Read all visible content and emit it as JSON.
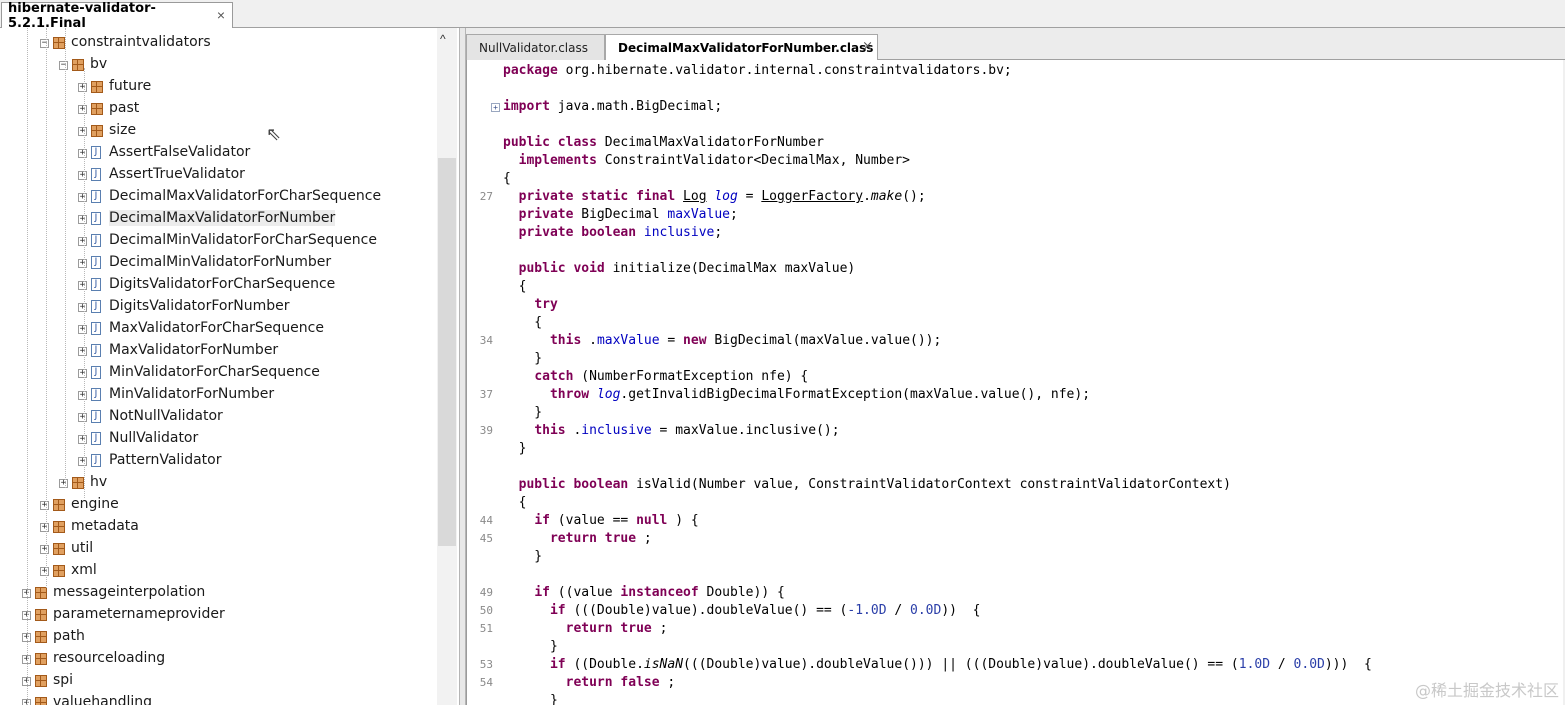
{
  "window_tab": {
    "title": "hibernate-validator-5.2.1.Final",
    "close": "×"
  },
  "tree": {
    "nodes": [
      {
        "label": "constraintvalidators",
        "kind": "package",
        "toggle": "−",
        "depth": 2
      },
      {
        "label": "bv",
        "kind": "package",
        "toggle": "−",
        "depth": 3
      },
      {
        "label": "future",
        "kind": "package",
        "toggle": "+",
        "depth": 4
      },
      {
        "label": "past",
        "kind": "package",
        "toggle": "+",
        "depth": 4
      },
      {
        "label": "size",
        "kind": "package",
        "toggle": "+",
        "depth": 4
      },
      {
        "label": "AssertFalseValidator",
        "kind": "class",
        "toggle": "+",
        "depth": 4
      },
      {
        "label": "AssertTrueValidator",
        "kind": "class",
        "toggle": "+",
        "depth": 4
      },
      {
        "label": "DecimalMaxValidatorForCharSequence",
        "kind": "class",
        "toggle": "+",
        "depth": 4
      },
      {
        "label": "DecimalMaxValidatorForNumber",
        "kind": "class",
        "toggle": "+",
        "depth": 4,
        "selected": true
      },
      {
        "label": "DecimalMinValidatorForCharSequence",
        "kind": "class",
        "toggle": "+",
        "depth": 4
      },
      {
        "label": "DecimalMinValidatorForNumber",
        "kind": "class",
        "toggle": "+",
        "depth": 4
      },
      {
        "label": "DigitsValidatorForCharSequence",
        "kind": "class",
        "toggle": "+",
        "depth": 4
      },
      {
        "label": "DigitsValidatorForNumber",
        "kind": "class",
        "toggle": "+",
        "depth": 4
      },
      {
        "label": "MaxValidatorForCharSequence",
        "kind": "class",
        "toggle": "+",
        "depth": 4
      },
      {
        "label": "MaxValidatorForNumber",
        "kind": "class",
        "toggle": "+",
        "depth": 4
      },
      {
        "label": "MinValidatorForCharSequence",
        "kind": "class",
        "toggle": "+",
        "depth": 4
      },
      {
        "label": "MinValidatorForNumber",
        "kind": "class",
        "toggle": "+",
        "depth": 4
      },
      {
        "label": "NotNullValidator",
        "kind": "class",
        "toggle": "+",
        "depth": 4
      },
      {
        "label": "NullValidator",
        "kind": "class",
        "toggle": "+",
        "depth": 4
      },
      {
        "label": "PatternValidator",
        "kind": "class",
        "toggle": "+",
        "depth": 4
      },
      {
        "label": "hv",
        "kind": "package",
        "toggle": "+",
        "depth": 3
      },
      {
        "label": "engine",
        "kind": "package",
        "toggle": "+",
        "depth": 2
      },
      {
        "label": "metadata",
        "kind": "package",
        "toggle": "+",
        "depth": 2
      },
      {
        "label": "util",
        "kind": "package",
        "toggle": "+",
        "depth": 2
      },
      {
        "label": "xml",
        "kind": "package",
        "toggle": "+",
        "depth": 2
      },
      {
        "label": "messageinterpolation",
        "kind": "package",
        "toggle": "+",
        "depth": 1
      },
      {
        "label": "parameternameprovider",
        "kind": "package",
        "toggle": "+",
        "depth": 1
      },
      {
        "label": "path",
        "kind": "package",
        "toggle": "+",
        "depth": 1
      },
      {
        "label": "resourceloading",
        "kind": "package",
        "toggle": "+",
        "depth": 1
      },
      {
        "label": "spi",
        "kind": "package",
        "toggle": "+",
        "depth": 1
      },
      {
        "label": "valuehandling",
        "kind": "package",
        "toggle": "+",
        "depth": 1
      }
    ],
    "scroll_up": "^"
  },
  "editor": {
    "tabs": [
      {
        "label": "NullValidator.class",
        "active": false
      },
      {
        "label": "DecimalMaxValidatorForNumber.class",
        "active": true,
        "close": "×"
      }
    ],
    "lines": [
      {
        "n": "",
        "fold": "",
        "segs": [
          [
            "kw",
            "package"
          ],
          [
            "",
            "org.hibernate.validator.internal.constraintvalidators.bv;"
          ]
        ]
      },
      {
        "n": "",
        "fold": "",
        "segs": []
      },
      {
        "n": "",
        "fold": "+",
        "segs": [
          [
            "kw",
            "import"
          ],
          [
            "",
            "java.math.BigDecimal;"
          ]
        ]
      },
      {
        "n": "",
        "fold": "",
        "segs": []
      },
      {
        "n": "",
        "fold": "",
        "segs": [
          [
            "kw",
            "public"
          ],
          [
            "",
            " "
          ],
          [
            "kw",
            "class"
          ],
          [
            "",
            " DecimalMaxValidatorForNumber"
          ]
        ]
      },
      {
        "n": "",
        "fold": "",
        "segs": [
          [
            "",
            "  "
          ],
          [
            "kw",
            "implements"
          ],
          [
            "",
            " ConstraintValidator<DecimalMax, Number>"
          ]
        ]
      },
      {
        "n": "",
        "fold": "",
        "segs": [
          [
            "",
            "{"
          ]
        ]
      },
      {
        "n": "27",
        "fold": "",
        "segs": [
          [
            "",
            "  "
          ],
          [
            "kw",
            "private"
          ],
          [
            "",
            " "
          ],
          [
            "kw",
            "static"
          ],
          [
            "",
            " "
          ],
          [
            "kw",
            "final"
          ],
          [
            "",
            " "
          ],
          [
            "ul",
            "Log"
          ],
          [
            "",
            " "
          ],
          [
            "fld ital",
            "log"
          ],
          [
            "",
            " = "
          ],
          [
            "ul",
            "LoggerFactory"
          ],
          [
            "",
            "."
          ],
          [
            "ital",
            "make"
          ],
          [
            "",
            "();"
          ]
        ]
      },
      {
        "n": "",
        "fold": "",
        "segs": [
          [
            "",
            "  "
          ],
          [
            "kw",
            "private"
          ],
          [
            "",
            " BigDecimal "
          ],
          [
            "fld",
            "maxValue"
          ],
          [
            "",
            ";"
          ]
        ]
      },
      {
        "n": "",
        "fold": "",
        "segs": [
          [
            "",
            "  "
          ],
          [
            "kw",
            "private"
          ],
          [
            "",
            " "
          ],
          [
            "kw",
            "boolean"
          ],
          [
            "",
            " "
          ],
          [
            "fld",
            "inclusive"
          ],
          [
            "",
            ";"
          ]
        ]
      },
      {
        "n": "",
        "fold": "",
        "segs": []
      },
      {
        "n": "",
        "fold": "",
        "segs": [
          [
            "",
            "  "
          ],
          [
            "kw",
            "public"
          ],
          [
            "",
            " "
          ],
          [
            "kw",
            "void"
          ],
          [
            "",
            " initialize(DecimalMax maxValue)"
          ]
        ]
      },
      {
        "n": "",
        "fold": "",
        "segs": [
          [
            "",
            "  {"
          ]
        ]
      },
      {
        "n": "",
        "fold": "",
        "segs": [
          [
            "",
            "    "
          ],
          [
            "kw",
            "try"
          ]
        ]
      },
      {
        "n": "",
        "fold": "",
        "segs": [
          [
            "",
            "    {"
          ]
        ]
      },
      {
        "n": "34",
        "fold": "",
        "segs": [
          [
            "",
            "      "
          ],
          [
            "kw",
            "this"
          ],
          [
            "",
            "."
          ],
          [
            "fld",
            "maxValue"
          ],
          [
            "",
            " = "
          ],
          [
            "kw",
            "new"
          ],
          [
            "",
            " BigDecimal(maxValue.value());"
          ]
        ]
      },
      {
        "n": "",
        "fold": "",
        "segs": [
          [
            "",
            "    }"
          ]
        ]
      },
      {
        "n": "",
        "fold": "",
        "segs": [
          [
            "",
            "    "
          ],
          [
            "kw",
            "catch"
          ],
          [
            "",
            " (NumberFormatException nfe) {"
          ]
        ]
      },
      {
        "n": "37",
        "fold": "",
        "segs": [
          [
            "",
            "      "
          ],
          [
            "kw",
            "throw"
          ],
          [
            "",
            " "
          ],
          [
            "fld ital",
            "log"
          ],
          [
            "",
            ".getInvalidBigDecimalFormatException(maxValue.value(), nfe);"
          ]
        ]
      },
      {
        "n": "",
        "fold": "",
        "segs": [
          [
            "",
            "    }"
          ]
        ]
      },
      {
        "n": "39",
        "fold": "",
        "segs": [
          [
            "",
            "    "
          ],
          [
            "kw",
            "this"
          ],
          [
            "",
            "."
          ],
          [
            "fld",
            "inclusive"
          ],
          [
            "",
            " = maxValue.inclusive();"
          ]
        ]
      },
      {
        "n": "",
        "fold": "",
        "segs": [
          [
            "",
            "  }"
          ]
        ]
      },
      {
        "n": "",
        "fold": "",
        "segs": []
      },
      {
        "n": "",
        "fold": "",
        "segs": [
          [
            "",
            "  "
          ],
          [
            "kw",
            "public"
          ],
          [
            "",
            " "
          ],
          [
            "kw",
            "boolean"
          ],
          [
            "",
            " isValid(Number value, ConstraintValidatorContext constraintValidatorContext)"
          ]
        ]
      },
      {
        "n": "",
        "fold": "",
        "segs": [
          [
            "",
            "  {"
          ]
        ]
      },
      {
        "n": "44",
        "fold": "",
        "segs": [
          [
            "",
            "    "
          ],
          [
            "kw",
            "if"
          ],
          [
            "",
            " (value == "
          ],
          [
            "kw",
            "null"
          ],
          [
            "",
            ") {"
          ]
        ]
      },
      {
        "n": "45",
        "fold": "",
        "segs": [
          [
            "",
            "      "
          ],
          [
            "kw",
            "return"
          ],
          [
            "",
            " "
          ],
          [
            "kw",
            "true"
          ],
          [
            "",
            ";"
          ]
        ]
      },
      {
        "n": "",
        "fold": "",
        "segs": [
          [
            "",
            "    }"
          ]
        ]
      },
      {
        "n": "",
        "fold": "",
        "segs": []
      },
      {
        "n": "49",
        "fold": "",
        "segs": [
          [
            "",
            "    "
          ],
          [
            "kw",
            "if"
          ],
          [
            "",
            " ((value "
          ],
          [
            "kw",
            "instanceof"
          ],
          [
            "",
            " Double)) {"
          ]
        ]
      },
      {
        "n": "50",
        "fold": "",
        "segs": [
          [
            "",
            "      "
          ],
          [
            "kw",
            "if"
          ],
          [
            "",
            " (((Double)value).doubleValue() == ("
          ],
          [
            "num",
            "-1.0D"
          ],
          [
            "",
            " / "
          ],
          [
            "num",
            "0.0D"
          ],
          [
            "",
            "))  {"
          ]
        ]
      },
      {
        "n": "51",
        "fold": "",
        "segs": [
          [
            "",
            "        "
          ],
          [
            "kw",
            "return"
          ],
          [
            "",
            " "
          ],
          [
            "kw",
            "true"
          ],
          [
            "",
            ";"
          ]
        ]
      },
      {
        "n": "",
        "fold": "",
        "segs": [
          [
            "",
            "      }"
          ]
        ]
      },
      {
        "n": "53",
        "fold": "",
        "segs": [
          [
            "",
            "      "
          ],
          [
            "kw",
            "if"
          ],
          [
            "",
            " ((Double."
          ],
          [
            "ital",
            "isNaN"
          ],
          [
            "",
            "(((Double)value).doubleValue())) || (((Double)value).doubleValue() == ("
          ],
          [
            "num",
            "1.0D"
          ],
          [
            "",
            " / "
          ],
          [
            "num",
            "0.0D"
          ],
          [
            "",
            ")))  {"
          ]
        ]
      },
      {
        "n": "54",
        "fold": "",
        "segs": [
          [
            "",
            "        "
          ],
          [
            "kw",
            "return"
          ],
          [
            "",
            " "
          ],
          [
            "kw",
            "false"
          ],
          [
            "",
            ";"
          ]
        ]
      },
      {
        "n": "",
        "fold": "",
        "segs": [
          [
            "",
            "      }"
          ]
        ]
      }
    ]
  },
  "watermark": "@稀土掘金技术社区",
  "colors": {
    "keyword": "#7f0055",
    "field": "#0000c0",
    "number": "#2a3ea8",
    "line_number": "#8a8a8a"
  }
}
